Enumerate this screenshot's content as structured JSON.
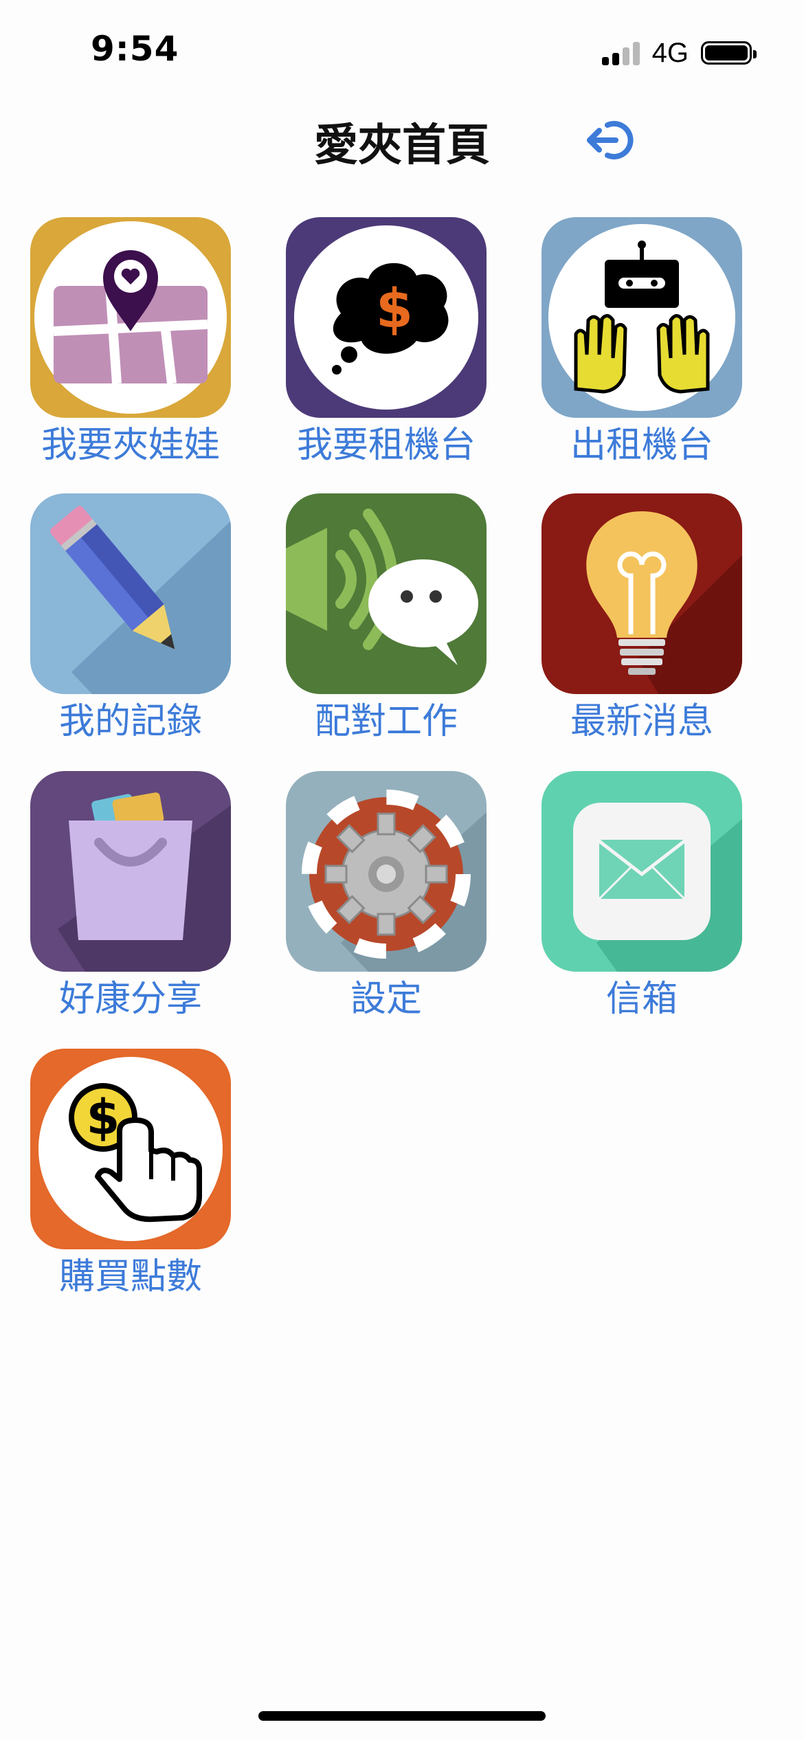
{
  "status_bar": {
    "time": "9:54",
    "network": "4G"
  },
  "header": {
    "title": "愛夾首頁"
  },
  "tiles": [
    {
      "label": "我要夾娃娃",
      "icon": "map-pin-icon"
    },
    {
      "label": "我要租機台",
      "icon": "money-thought-icon"
    },
    {
      "label": "出租機台",
      "icon": "robot-hands-icon"
    },
    {
      "label": "我的記錄",
      "icon": "pencil-icon"
    },
    {
      "label": "配對工作",
      "icon": "speaker-chat-icon"
    },
    {
      "label": "最新消息",
      "icon": "lightbulb-icon"
    },
    {
      "label": "好康分享",
      "icon": "shopping-bag-icon"
    },
    {
      "label": "設定",
      "icon": "gear-icon"
    },
    {
      "label": "信箱",
      "icon": "envelope-icon"
    },
    {
      "label": "購買點數",
      "icon": "coin-tap-icon"
    }
  ],
  "colors": {
    "label": "#3d7bd9",
    "accent": "#3d7bd9"
  }
}
